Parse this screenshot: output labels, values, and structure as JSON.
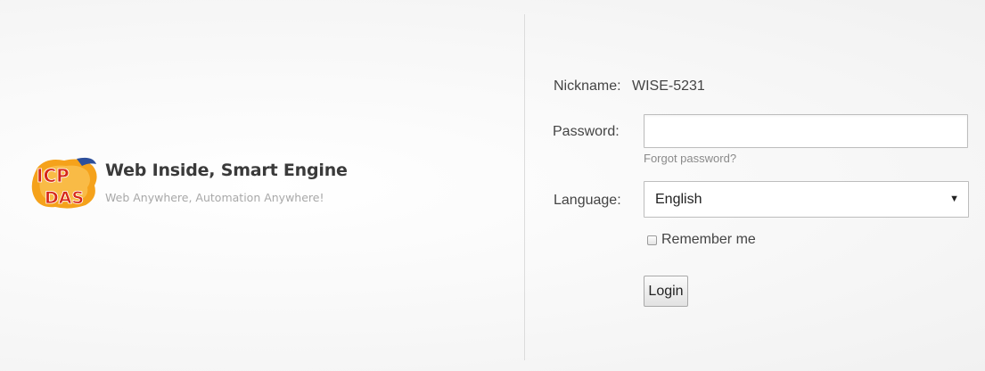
{
  "brand": {
    "logo_icon": "icpdas-logo-icon",
    "title": "Web Inside, Smart Engine",
    "tagline": "Web Anywhere, Automation Anywhere!"
  },
  "form": {
    "nickname_label": "Nickname:",
    "nickname_value": "WISE-5231",
    "password_label": "Password:",
    "password_value": "",
    "forgot_password_link": "Forgot password?",
    "language_label": "Language:",
    "language_selected": "English",
    "remember_me_label": "Remember me",
    "remember_me_checked": false,
    "login_button": "Login"
  },
  "colors": {
    "logo_red": "#d62718",
    "logo_orange": "#f5a21b",
    "logo_blue": "#2d4f9b"
  }
}
